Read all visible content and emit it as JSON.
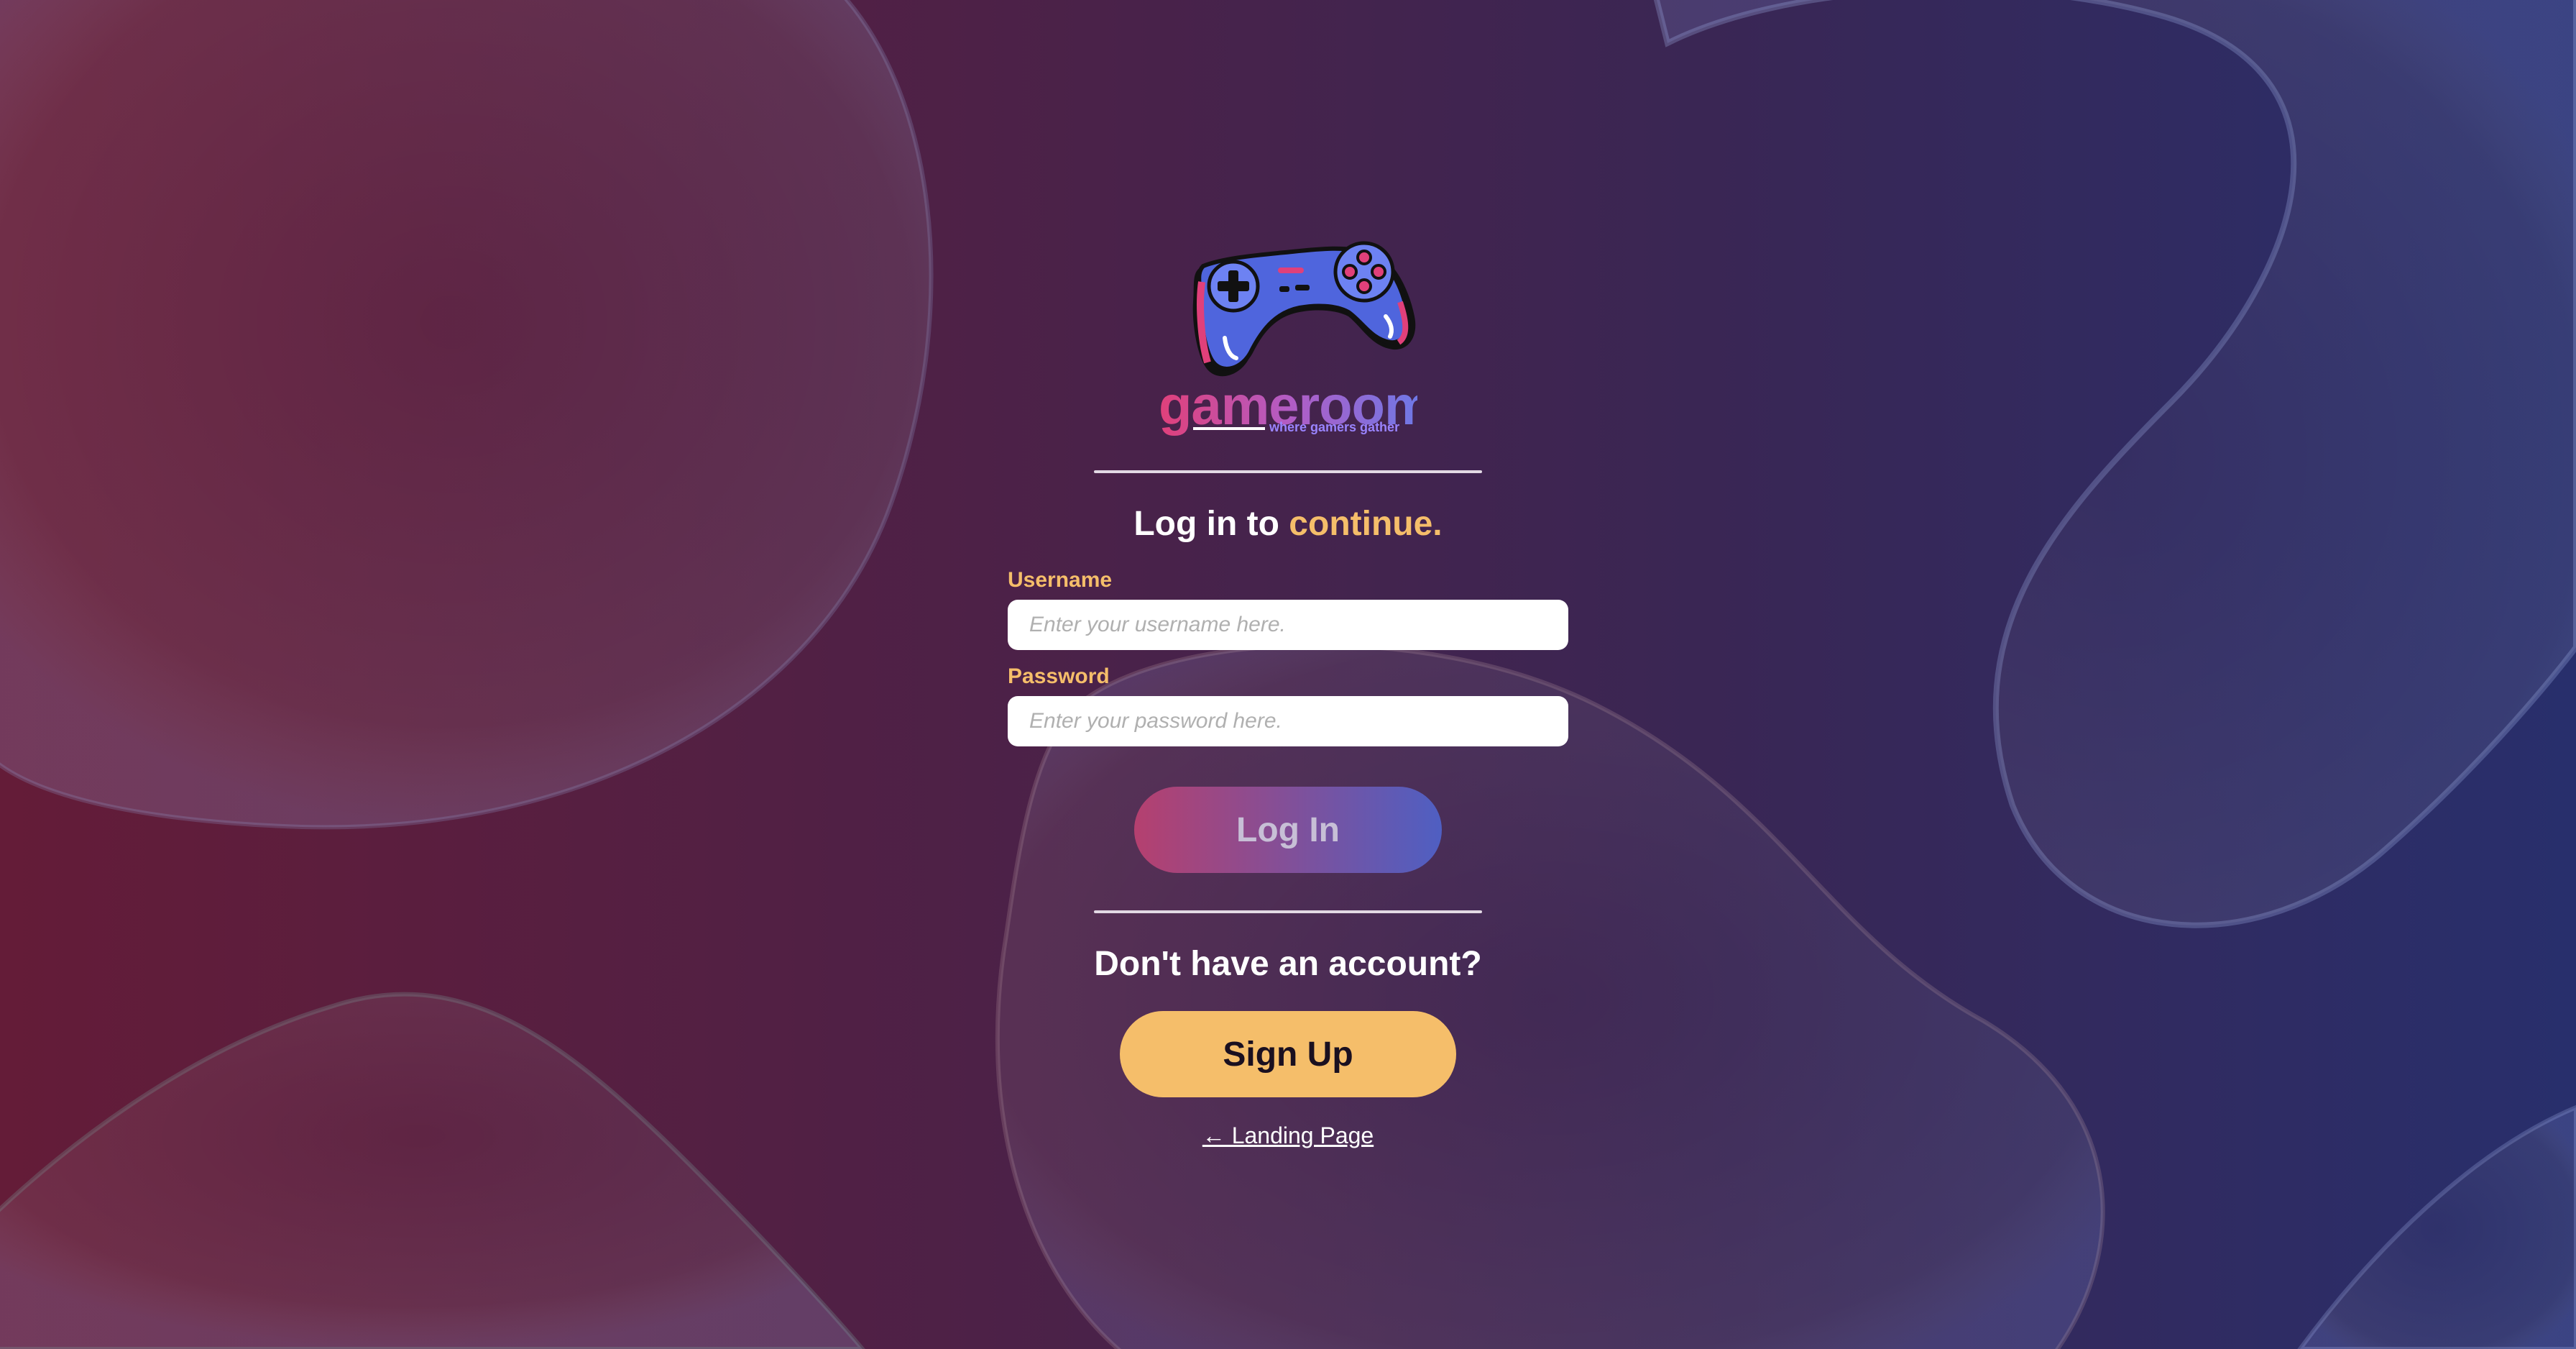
{
  "brand": {
    "name": "gameroom.",
    "tagline": "where gamers gather",
    "logo_icon": "gamepad-icon"
  },
  "login": {
    "heading_prefix": "Log in to",
    "heading_accent": "continue.",
    "username_label": "Username",
    "username_placeholder": "Enter your username here.",
    "username_value": "",
    "password_label": "Password",
    "password_placeholder": "Enter your password here.",
    "password_value": "",
    "login_button": "Log In"
  },
  "signup": {
    "prompt": "Don't have an account?",
    "button": "Sign Up"
  },
  "landing_link": "← Landing Page",
  "colors": {
    "accent": "#f5be6a",
    "brand_pink": "#e0407a",
    "brand_blue": "#6f78e6"
  }
}
